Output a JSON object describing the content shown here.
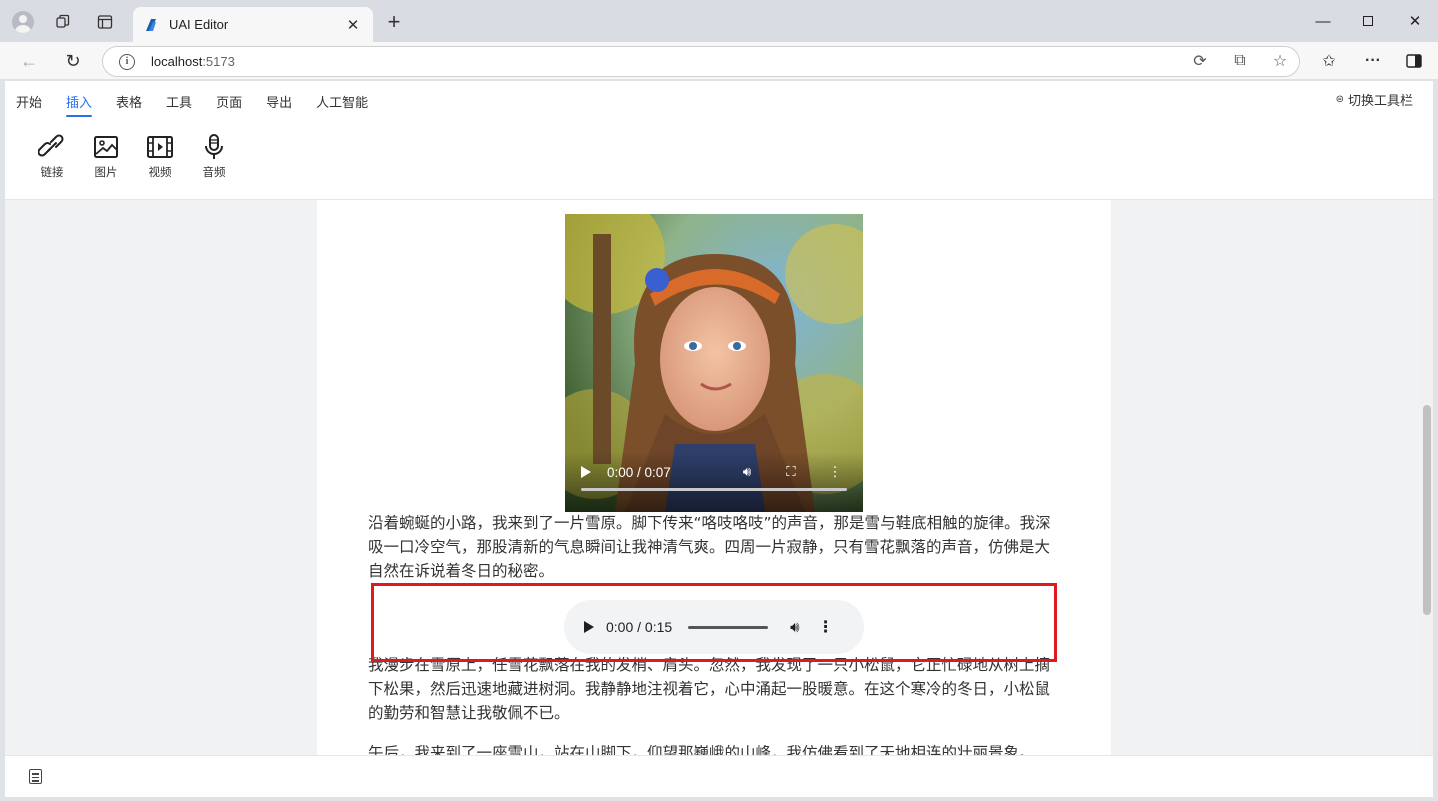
{
  "browser": {
    "tab_title": "UAI Editor",
    "url_host": "localhost",
    "url_port": ":5173",
    "icons": [
      "profile-icon",
      "workspaces-icon",
      "tab-actions-icon",
      "back-icon",
      "refresh-icon",
      "site-info-icon",
      "read-aloud-icon",
      "app-available-icon",
      "favorite-star-icon",
      "favorites-icon",
      "more-icon",
      "sidebar-icon"
    ]
  },
  "menu": {
    "items": [
      "开始",
      "插入",
      "表格",
      "工具",
      "页面",
      "导出",
      "人工智能"
    ],
    "active": "插入",
    "toggle_label": "切换工具栏"
  },
  "insert_tools": [
    {
      "label": "链接",
      "icon": "link-icon"
    },
    {
      "label": "图片",
      "icon": "image-icon"
    },
    {
      "label": "视频",
      "icon": "video-icon"
    },
    {
      "label": "音频",
      "icon": "microphone-icon"
    }
  ],
  "video": {
    "time": "0:00 / 0:07"
  },
  "audio": {
    "time": "0:00 / 0:15"
  },
  "paragraphs": [
    "沿着蜿蜒的小路，我来到了一片雪原。脚下传来“咯吱咯吱”的声音，那是雪与鞋底相触的旋律。我深吸一口冷空气，那股清新的气息瞬间让我神清气爽。四周一片寂静，只有雪花飘落的声音，仿佛是大自然在诉说着冬日的秘密。",
    "我漫步在雪原上，任雪花飘落在我的发梢、肩头。忽然，我发现了一只小松鼠，它正忙碌地从树上摘下松果，然后迅速地藏进树洞。我静静地注视着它，心中涌起一股暖意。在这个寒冷的冬日，小松鼠的勤劳和智慧让我敬佩不已。",
    "午后，我来到了一座雪山，站在山脚下，仰望那巍峨的山峰，我仿佛看到了天地相连的壮丽景象。"
  ],
  "colors": {
    "accent": "#2a6ff0",
    "highlight_box": "#e0191e"
  }
}
